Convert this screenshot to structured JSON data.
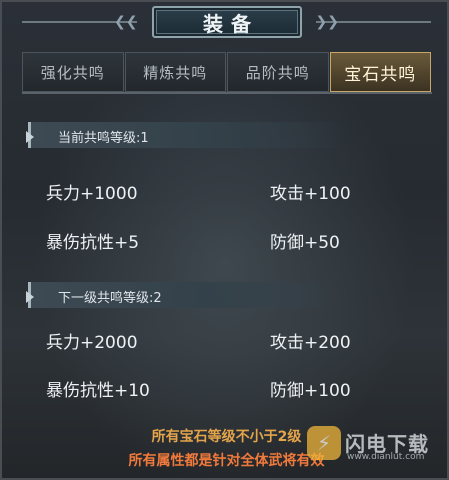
{
  "title": "装备",
  "tabs": [
    {
      "label": "强化共鸣",
      "active": false
    },
    {
      "label": "精炼共鸣",
      "active": false
    },
    {
      "label": "品阶共鸣",
      "active": false
    },
    {
      "label": "宝石共鸣",
      "active": true
    }
  ],
  "current_level": {
    "header": "当前共鸣等级:1",
    "stats": [
      "兵力+1000",
      "攻击+100",
      "暴伤抗性+5",
      "防御+50"
    ]
  },
  "next_level": {
    "header": "下一级共鸣等级:2",
    "stats": [
      "兵力+2000",
      "攻击+200",
      "暴伤抗性+10",
      "防御+100"
    ]
  },
  "footer": {
    "line1": "所有宝石等级不小于2级",
    "line2": "所有属性都是针对全体武将有效"
  },
  "watermark": {
    "name": "闪电下载",
    "url": "www.dianlut.com"
  },
  "colors": {
    "active_tab_border": "#c7a66a",
    "footer_line1": "#e4a44a",
    "footer_line2": "#f07a3c"
  }
}
